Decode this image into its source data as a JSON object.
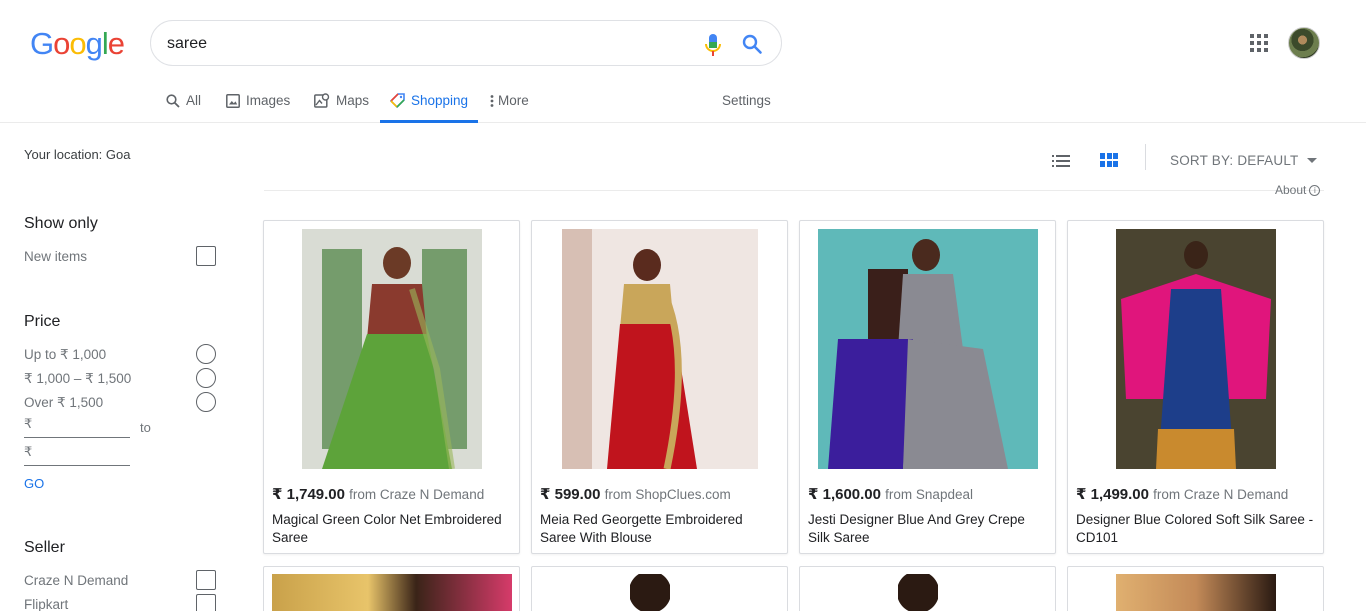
{
  "logo": {
    "letters": [
      "G",
      "o",
      "o",
      "g",
      "l",
      "e"
    ],
    "colors": [
      "#4285f4",
      "#ea4335",
      "#fbbc05",
      "#4285f4",
      "#34a853",
      "#ea4335"
    ]
  },
  "search": {
    "query": "saree"
  },
  "tabs": [
    {
      "label": "All",
      "icon": "search-icon"
    },
    {
      "label": "Images",
      "icon": "image-icon"
    },
    {
      "label": "Maps",
      "icon": "map-icon"
    },
    {
      "label": "Shopping",
      "icon": "shopping-tag-icon",
      "active": true
    },
    {
      "label": "More",
      "icon": "more-vert-icon"
    },
    {
      "label": "Settings"
    }
  ],
  "sidebar": {
    "location": "Your location: Goa",
    "show_only": {
      "title": "Show only",
      "items": [
        "New items"
      ]
    },
    "price": {
      "title": "Price",
      "ranges": [
        "Up to ₹ 1,000",
        "₹ 1,000 – ₹ 1,500",
        "Over ₹ 1,500"
      ],
      "currency": "₹",
      "to_label": "to",
      "go_label": "GO"
    },
    "seller": {
      "title": "Seller",
      "items": [
        "Craze N Demand",
        "Flipkart"
      ]
    }
  },
  "toolbar": {
    "sort_label": "SORT BY: DEFAULT",
    "about_label": "About",
    "view": "grid"
  },
  "products": [
    {
      "price": "₹ 1,749.00",
      "source": "from Craze N Demand",
      "title": "Magical Green Color Net Embroidered Saree",
      "colors": [
        "#d9dcd4",
        "#5da33a",
        "#8a3a2e"
      ]
    },
    {
      "price": "₹ 599.00",
      "source": "from ShopClues.com",
      "title": "Meia Red Georgette Embroidered Saree With Blouse",
      "colors": [
        "#efe6e2",
        "#c0141d",
        "#c9a65a"
      ]
    },
    {
      "price": "₹ 1,600.00",
      "source": "from Snapdeal",
      "title": "Jesti Designer Blue And Grey Crepe Silk Saree",
      "colors": [
        "#5fb9b9",
        "#3b1e9c",
        "#8a8a92"
      ]
    },
    {
      "price": "₹ 1,499.00",
      "source": "from Craze N Demand",
      "title": "Designer Blue Colored Soft Silk Saree - CD101",
      "colors": [
        "#4a4430",
        "#e0157c",
        "#1d3e8a"
      ]
    }
  ]
}
